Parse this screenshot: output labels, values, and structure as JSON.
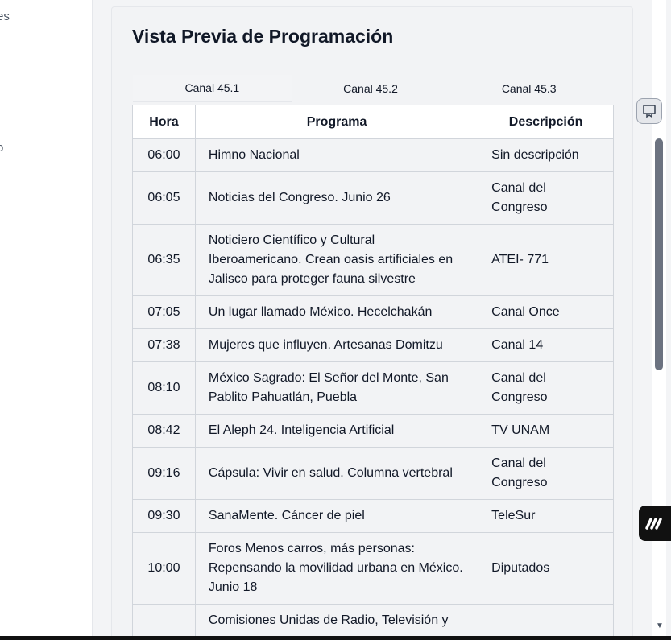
{
  "sidebar": {
    "fragment_top": "es",
    "fragment_mid": "o"
  },
  "preview": {
    "title": "Vista Previa de Programación",
    "tabs": [
      {
        "label": "Canal 45.1"
      },
      {
        "label": "Canal 45.2"
      },
      {
        "label": "Canal 45.3"
      }
    ],
    "table": {
      "headers": {
        "hora": "Hora",
        "programa": "Programa",
        "descripcion": "Descripción"
      },
      "rows": [
        {
          "hora": "06:00",
          "programa": "Himno Nacional",
          "descripcion": "Sin descripción"
        },
        {
          "hora": "06:05",
          "programa": "Noticias del Congreso. Junio 26",
          "descripcion": "Canal del Congreso"
        },
        {
          "hora": "06:35",
          "programa": "Noticiero Científico y Cultural Iberoamericano. Crean oasis artificiales en Jalisco para proteger fauna silvestre",
          "descripcion": "ATEI- 771"
        },
        {
          "hora": "07:05",
          "programa": "Un lugar llamado México. Hecelchakán",
          "descripcion": "Canal Once"
        },
        {
          "hora": "07:38",
          "programa": "Mujeres que influyen. Artesanas Domitzu",
          "descripcion": "Canal 14"
        },
        {
          "hora": "08:10",
          "programa": "México Sagrado: El Señor del Monte, San Pablito Pahuatlán, Puebla",
          "descripcion": "Canal del Congreso"
        },
        {
          "hora": "08:42",
          "programa": "El Aleph 24. Inteligencia Artificial",
          "descripcion": "TV UNAM"
        },
        {
          "hora": "09:16",
          "programa": "Cápsula: Vivir en salud. Columna vertebral",
          "descripcion": "Canal del Congreso"
        },
        {
          "hora": "09:30",
          "programa": "SanaMente. Cáncer de piel",
          "descripcion": "TeleSur"
        },
        {
          "hora": "10:00",
          "programa": "Foros Menos carros, más personas: Repensando la movilidad urbana en México. Junio 18",
          "descripcion": "Diputados"
        },
        {
          "hora": "",
          "programa": "Comisiones Unidas de Radio, Televisión y",
          "descripcion": ""
        }
      ]
    }
  },
  "icons": {
    "float_button": "bookmark-icon",
    "badge": "brand-logo-icon",
    "scroll_down": "chevron-down-icon"
  }
}
